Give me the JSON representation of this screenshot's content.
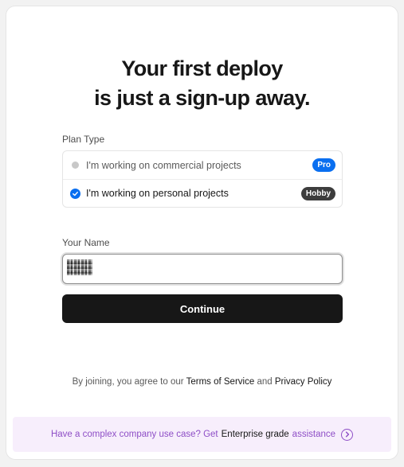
{
  "headline": {
    "line1": "Your first deploy",
    "line2": "is just a sign-up away."
  },
  "plan": {
    "label": "Plan Type",
    "options": [
      {
        "text": "I'm working on commercial projects",
        "badge": "Pro",
        "selected": false
      },
      {
        "text": "I'm working on personal projects",
        "badge": "Hobby",
        "selected": true
      }
    ]
  },
  "name": {
    "label": "Your Name"
  },
  "continue_label": "Continue",
  "legal": {
    "prefix": "By joining, you agree to our",
    "terms": "Terms of Service",
    "and": "and",
    "privacy": "Privacy Policy"
  },
  "enterprise": {
    "prefix": "Have a complex company use case? Get",
    "strong": "Enterprise grade",
    "suffix": "assistance",
    "icon": "arrow-right-circle-icon"
  },
  "colors": {
    "accent": "#0a6ff0",
    "button": "#171717",
    "enterprise_bg": "#f7eefc",
    "enterprise_text": "#8e4ec6"
  }
}
